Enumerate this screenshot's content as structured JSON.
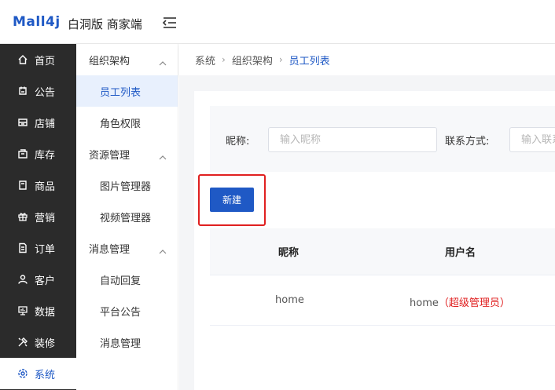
{
  "header": {
    "logo": "Mall4j",
    "edition": "白洞版 商家端"
  },
  "nav": {
    "items": [
      {
        "label": "首页",
        "icon": "home-icon"
      },
      {
        "label": "公告",
        "icon": "notice-icon"
      },
      {
        "label": "店铺",
        "icon": "store-icon"
      },
      {
        "label": "库存",
        "icon": "inventory-icon"
      },
      {
        "label": "商品",
        "icon": "product-icon"
      },
      {
        "label": "营销",
        "icon": "gift-icon"
      },
      {
        "label": "订单",
        "icon": "order-icon"
      },
      {
        "label": "客户",
        "icon": "customer-icon"
      },
      {
        "label": "数据",
        "icon": "data-icon"
      },
      {
        "label": "装修",
        "icon": "decor-icon"
      },
      {
        "label": "系统",
        "icon": "system-icon"
      }
    ],
    "active": "系统"
  },
  "submenu": {
    "groups": [
      {
        "label": "组织架构",
        "items": [
          "员工列表",
          "角色权限"
        ]
      },
      {
        "label": "资源管理",
        "items": [
          "图片管理器",
          "视频管理器"
        ]
      },
      {
        "label": "消息管理",
        "items": [
          "自动回复",
          "平台公告",
          "消息管理"
        ]
      }
    ],
    "active": "员工列表"
  },
  "breadcrumb": [
    "系统",
    "组织架构",
    "员工列表"
  ],
  "search": {
    "nick_label": "昵称:",
    "nick_placeholder": "输入昵称",
    "contact_label": "联系方式:",
    "contact_placeholder": "输入联系方式"
  },
  "actions": {
    "new_label": "新建"
  },
  "table": {
    "columns": [
      "昵称",
      "用户名"
    ],
    "rows": [
      {
        "nick": "home",
        "username": "home",
        "tag": "（超级管理员）"
      }
    ]
  },
  "colors": {
    "accent": "#1f59c5",
    "danger": "#e02020",
    "sidebar": "#2b2b2b"
  }
}
